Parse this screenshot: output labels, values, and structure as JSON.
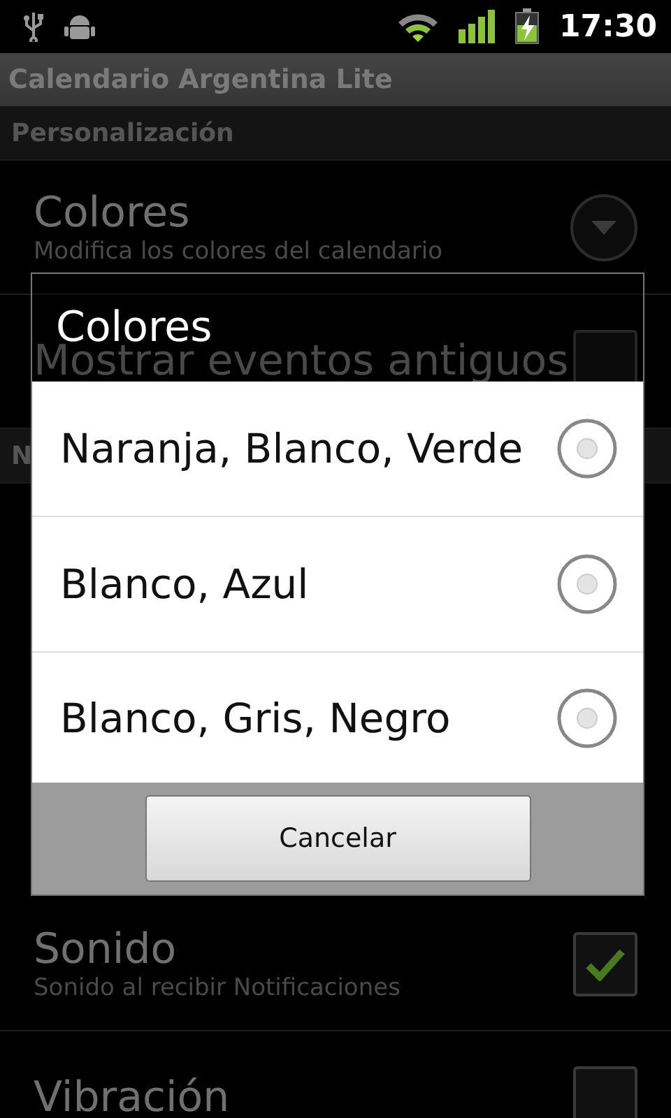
{
  "status_bar": {
    "time": "17:30"
  },
  "app_bar": {
    "title": "Calendario Argentina Lite"
  },
  "settings": [
    {
      "kind": "category",
      "title": "Personalización"
    },
    {
      "kind": "spinner",
      "title": "Colores",
      "summary": "Modifica los colores del calendario"
    },
    {
      "kind": "checkbox",
      "title": "Mostrar eventos antiguos",
      "checked": false
    },
    {
      "kind": "category",
      "title": "N"
    },
    {
      "kind": "hidden"
    },
    {
      "kind": "checkbox",
      "title": "Sonido",
      "summary": "Sonido al recibir Notificaciones",
      "checked": true
    },
    {
      "kind": "checkbox",
      "title": "Vibración",
      "checked": false
    }
  ],
  "dialog": {
    "title": "Colores",
    "options": [
      {
        "label": "Naranja, Blanco, Verde",
        "selected": false
      },
      {
        "label": "Blanco, Azul",
        "selected": false
      },
      {
        "label": "Blanco, Gris, Negro",
        "selected": false
      }
    ],
    "buttons": [
      "Cancelar"
    ]
  }
}
